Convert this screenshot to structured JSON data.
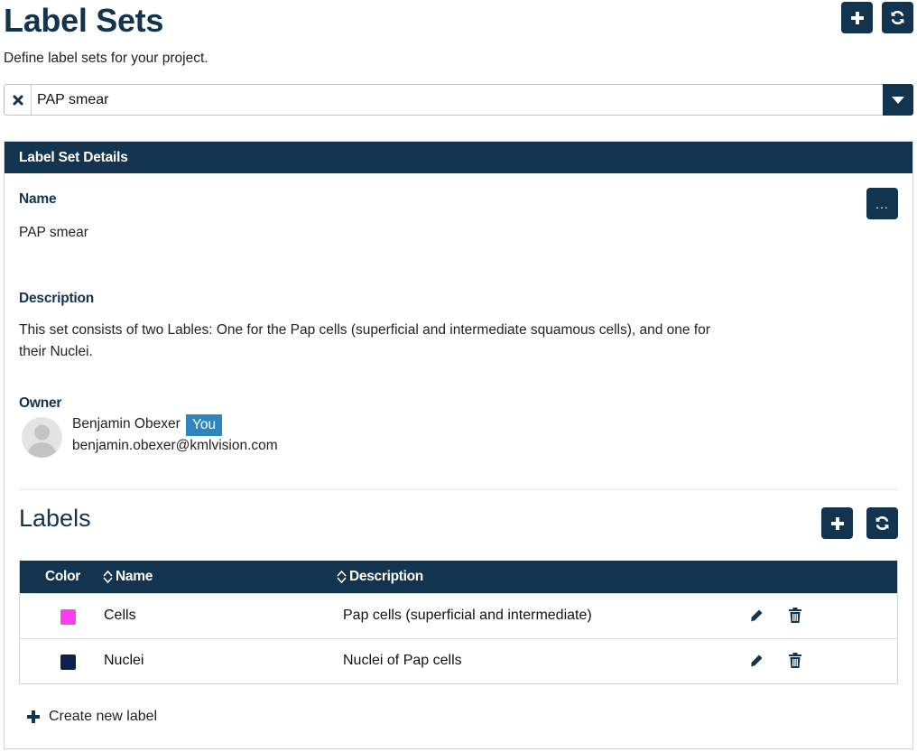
{
  "header": {
    "title": "Label Sets",
    "subtitle": "Define label sets for your project."
  },
  "selector": {
    "value": "PAP smear"
  },
  "details": {
    "header": "Label Set Details",
    "more_label": "...",
    "name_label": "Name",
    "name_value": "PAP smear",
    "description_label": "Description",
    "description_value": "This set consists of two Lables: One for the Pap cells (superficial and intermediate squamous cells), and one for their Nuclei.",
    "owner_label": "Owner",
    "owner_name": "Benjamin Obexer",
    "owner_badge": "You",
    "owner_email": "benjamin.obexer@kmlvision.com"
  },
  "labels": {
    "title": "Labels",
    "columns": {
      "color": "Color",
      "name": "Name",
      "description": "Description"
    },
    "rows": [
      {
        "color": "#ff3ef2",
        "name": "Cells",
        "description": "Pap cells (superficial and intermediate)"
      },
      {
        "color": "#0d1f4d",
        "name": "Nuclei",
        "description": "Nuclei of Pap cells"
      }
    ],
    "create_label": "Create new label"
  },
  "colors": {
    "primary": "#13344e",
    "badge": "#2f86bf"
  }
}
